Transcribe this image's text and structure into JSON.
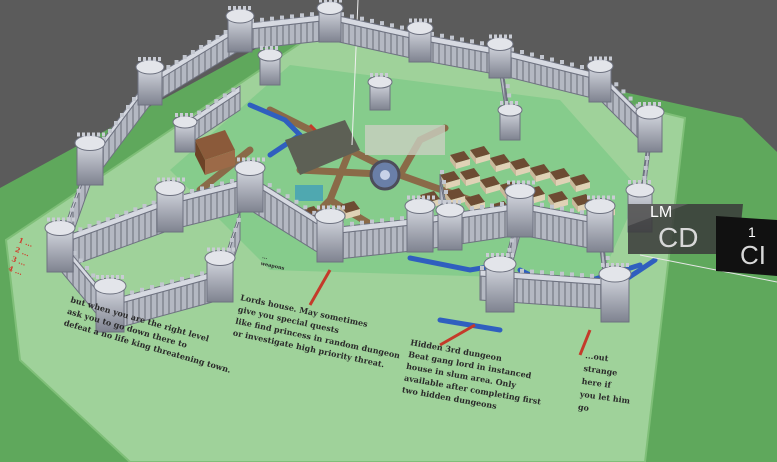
{
  "scene": {
    "background_color": "#5a5a5a",
    "ground_color": "#6db36b",
    "map_color": "#a9d8a5",
    "wall_color": "#b9bcc6"
  },
  "notes": {
    "left_red_lines": [
      "1 ...",
      "2 ...",
      "3 ...",
      "4 ..."
    ],
    "bottom_left": [
      "but when you are the right level",
      "ask you to go down there to",
      "defeat a no life king threatening town."
    ],
    "lords_house": [
      "Lords house. May sometimes",
      "give you special quests",
      "like find princess in random dungeon",
      "or investigate high priority threat."
    ],
    "hidden_dungeon": [
      "Hidden 3rd dungeon",
      "Beat gang lord in instanced",
      "house in slum area. Only",
      "available after completing first",
      "two hidden dungeons"
    ],
    "right_edge": [
      "...out",
      "strange",
      "here if",
      "you let him",
      "go"
    ],
    "small_center": [
      "...",
      "weapons"
    ]
  },
  "overlay": {
    "lm_label": "LM",
    "lm_code": "CD",
    "index_label": "1",
    "index_code": "CI"
  }
}
